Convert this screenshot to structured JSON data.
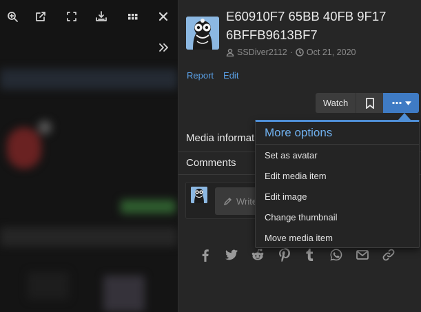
{
  "viewer": {
    "toolbar_icons": [
      "zoom-in-icon",
      "open-external-icon",
      "fullscreen-icon",
      "download-icon",
      "grid-icon",
      "close-icon"
    ],
    "sidebar_toggle_icon": "double-chevron-right-icon"
  },
  "media": {
    "title": "E60910F7 65BB 40FB 9F17 6BFFB9613BF7",
    "author": "SSDiver2112",
    "date": "Oct 21, 2020",
    "links": {
      "report": "Report",
      "edit": "Edit"
    }
  },
  "buttons": {
    "watch": "Watch",
    "more": "•••"
  },
  "sections": {
    "media_information": "Media informat",
    "comments": "Comments"
  },
  "comment": {
    "placeholder": "Write"
  },
  "share_icons": [
    "facebook-icon",
    "twitter-icon",
    "reddit-icon",
    "pinterest-icon",
    "tumblr-icon",
    "whatsapp-icon",
    "email-icon",
    "link-icon"
  ],
  "dropdown": {
    "title": "More options",
    "items": [
      "Set as avatar",
      "Edit media item",
      "Edit image",
      "Change thumbnail",
      "Move media item"
    ]
  },
  "colors": {
    "accent": "#4f8fd6",
    "link": "#5aa0e6",
    "button_primary": "#3f7bc4",
    "panel_bg": "#262626"
  }
}
